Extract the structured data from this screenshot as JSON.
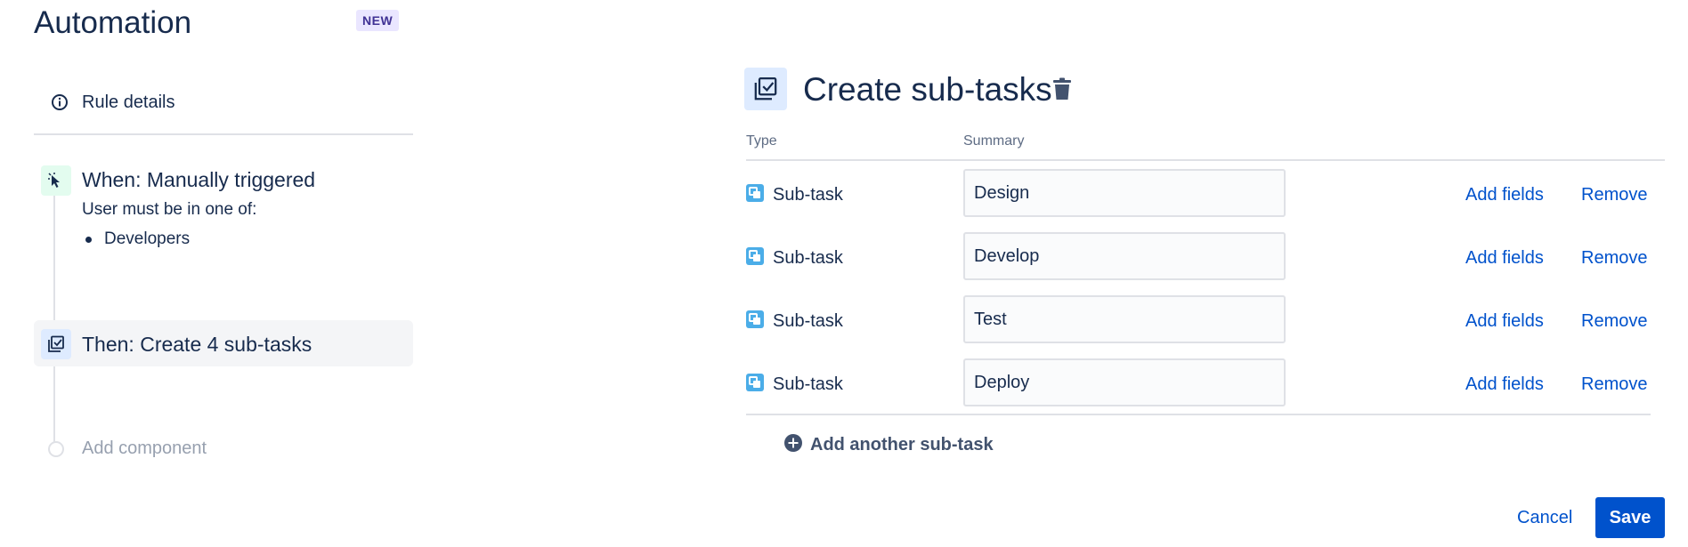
{
  "app": {
    "title": "Automation",
    "badge": "NEW"
  },
  "sidebar": {
    "rule_details": {
      "label": "Rule details",
      "icon": "info-icon"
    },
    "trigger": {
      "title": "When: Manually triggered",
      "subtitle": "User must be in one of:",
      "groups": [
        "Developers"
      ],
      "icon": "cursor-click-icon"
    },
    "action": {
      "title": "Then: Create 4 sub-tasks",
      "icon": "subtask-checkbox-icon"
    },
    "add_component": {
      "label": "Add component"
    }
  },
  "editor": {
    "title": "Create sub-tasks",
    "icon": "subtask-checkbox-icon",
    "columns": {
      "type": "Type",
      "summary": "Summary"
    },
    "rows": [
      {
        "type": "Sub-task",
        "summary": "Design",
        "add_fields": "Add fields",
        "remove": "Remove"
      },
      {
        "type": "Sub-task",
        "summary": "Develop",
        "add_fields": "Add fields",
        "remove": "Remove"
      },
      {
        "type": "Sub-task",
        "summary": "Test",
        "add_fields": "Add fields",
        "remove": "Remove"
      },
      {
        "type": "Sub-task",
        "summary": "Deploy",
        "add_fields": "Add fields",
        "remove": "Remove"
      }
    ],
    "add_another": "Add another sub-task",
    "cancel": "Cancel",
    "save": "Save"
  },
  "colors": {
    "primary": "#0052CC",
    "text": "#172B4D",
    "subtask_icon": "#4BADE8",
    "badge_bg": "#EAE6FF",
    "badge_text": "#403294"
  }
}
